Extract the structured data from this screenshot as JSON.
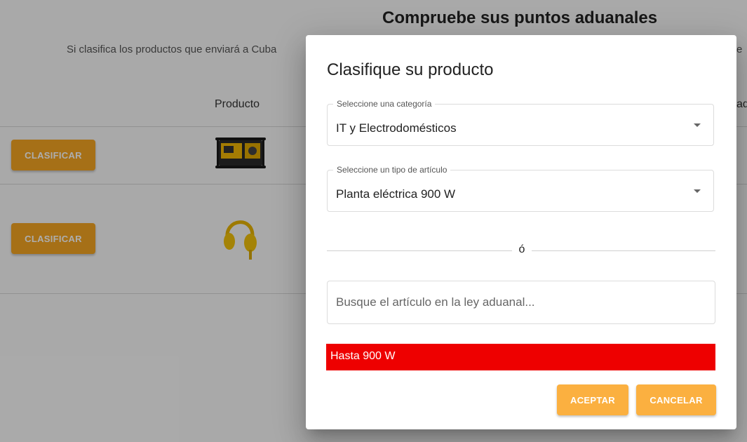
{
  "background": {
    "title": "Compruebe sus puntos aduanales",
    "subtitle": "Si clasifica los productos que enviará a Cuba",
    "subtitle_tail": "e",
    "table": {
      "column_producto": "Producto",
      "column_tail": "ad"
    },
    "rows": [
      {
        "button_label": "CLASIFICAR",
        "product_image": "generator-image"
      },
      {
        "button_label": "CLASIFICAR",
        "product_image": "headphones-image"
      }
    ],
    "colors": {
      "accent": "#f5a623"
    }
  },
  "modal": {
    "title": "Clasifique su producto",
    "category": {
      "legend": "Seleccione una categoría",
      "value": "IT y Electrodomésticos"
    },
    "article_type": {
      "legend": "Seleccione un tipo de artículo",
      "value": "Planta eléctrica 900 W"
    },
    "divider_text": "ó",
    "search": {
      "placeholder": "Busque el artículo en la ley aduanal...",
      "value": ""
    },
    "alert_text": "Hasta 900 W",
    "buttons": {
      "accept": "ACEPTAR",
      "cancel": "CANCELAR"
    },
    "colors": {
      "alert": "#ee0000",
      "button": "#fbb040"
    }
  }
}
